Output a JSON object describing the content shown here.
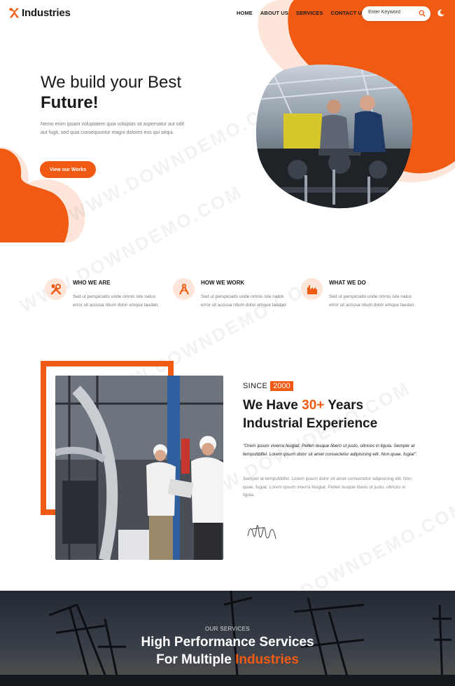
{
  "header": {
    "logo_text": "Industries",
    "nav": [
      "HOME",
      "ABOUT US",
      "SERVICES",
      "CONTACT US"
    ],
    "search_placeholder": "Enter Keyword"
  },
  "hero": {
    "title_line1": "We build your Best",
    "title_line2": "Future!",
    "description": "Nemo enim ipsam voluptatem quia voluptas sit aspernatur aut odit aut fugit, sed quia consequuntur magni dolores eos qui sequi.",
    "button_label": "View our Works"
  },
  "features": [
    {
      "title": "WHO WE ARE",
      "text": "Sed ut perspiciatis unde omnis iste natus error sit accusa ntium dolor emque laudan.",
      "icon": "tools-icon"
    },
    {
      "title": "HOW WE WORK",
      "text": "Sed ut perspiciatis unde omnis iste natus error sit accusa ntium dolor emque laudan.",
      "icon": "compass-icon"
    },
    {
      "title": "WHAT WE DO",
      "text": "Sed ut perspiciatis unde omnis iste natus error sit accusa ntium dolor emque laudan.",
      "icon": "factory-icon"
    }
  ],
  "experience": {
    "since_label": "SINCE",
    "since_year": "2000",
    "title_prefix": "We Have ",
    "title_accent": "30+",
    "title_suffix": " Years",
    "title_line2": "Industrial Experience",
    "quote": "\"Orem ipsum viverra feugiat. Pellen tesque libero ut justo, ultrices in ligula. Semper at tempufddfel. Lorem ipsum dolor sit amet consectetur adipisicing elit. Non quae, fugiat\".",
    "body": "Semper at tempufddfel. Lorem ipsum dolor sit amet consectetur adipisicing elit. Non quae, fugiat. Lorem ipsum viverra feugiat. Pellen tesque libero ut justo, ultrices in ligula."
  },
  "services": {
    "label": "OUR SERVICES",
    "title_line1": "High Performance Services",
    "title_line2_prefix": "For Multiple ",
    "title_line2_accent": "Industries"
  },
  "watermark_text": "WWW.DOWNDEMO.COM",
  "colors": {
    "accent": "#f15a12",
    "accent_light": "#fde6d9",
    "dark": "#1a1a1a"
  }
}
